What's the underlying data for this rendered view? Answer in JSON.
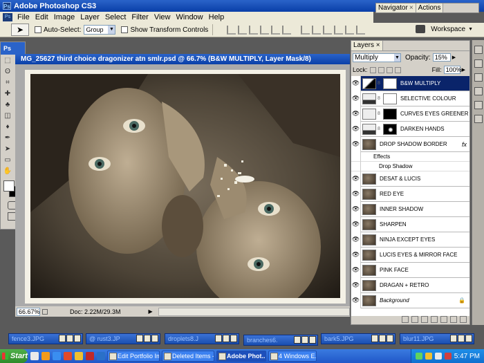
{
  "app": {
    "title": "Adobe Photoshop CS3",
    "ps_badge": "Ps"
  },
  "menu": [
    "File",
    "Edit",
    "Image",
    "Layer",
    "Select",
    "Filter",
    "View",
    "Window",
    "Help"
  ],
  "navtabs": {
    "navigator": "Navigator",
    "actions": "Actions",
    "close": "×"
  },
  "options": {
    "auto_select_label": "Auto-Select:",
    "auto_select_value": "Group",
    "show_transform_label": "Show Transform Controls",
    "workspace_label": "Workspace"
  },
  "toolbox": {
    "title": "Ps"
  },
  "document": {
    "title": "MG_25627 third choice dragonizer atn smlr.psd @ 66.7% (B&W MULTIPLY, Layer Mask/8)",
    "zoom": "66.67%",
    "doc_info": "Doc: 2.22M/29.3M"
  },
  "layers": {
    "tab": "Layers",
    "close": "×",
    "blend_mode": "Multiply",
    "opacity_label": "Opacity:",
    "opacity": "15%",
    "lock_label": "Lock:",
    "fill_label": "Fill:",
    "fill": "100%",
    "items": [
      {
        "name": "B&W MULTIPLY"
      },
      {
        "name": "SELECTIVE COLOUR"
      },
      {
        "name": "CURVES EYES GREENER"
      },
      {
        "name": "DARKEN HANDS"
      },
      {
        "name": "DROP SHADOW BORDER",
        "fx": "fx"
      },
      {
        "name": "Effects"
      },
      {
        "name": "Drop Shadow"
      },
      {
        "name": "DESAT & LUCIS"
      },
      {
        "name": "RED EYE"
      },
      {
        "name": "INNER SHADOW"
      },
      {
        "name": "SHARPEN"
      },
      {
        "name": "NINJA EXCEPT EYES"
      },
      {
        "name": "LUCIS EYES & MIRROR FACE"
      },
      {
        "name": "PINK FACE"
      },
      {
        "name": "DRAGAN + RETRO"
      },
      {
        "name": "Background"
      }
    ]
  },
  "minimized": [
    {
      "label": "fence3.JPG"
    },
    {
      "label": "@ rust3.JP"
    },
    {
      "label": "droplets8.J"
    },
    {
      "label": "branches6."
    },
    {
      "label": "bark5.JPG"
    },
    {
      "label": "blur11.JPG"
    }
  ],
  "taskbar": {
    "start": "Start",
    "tasks": [
      "Edit Portfolio Im...",
      "Deleted Items - ...",
      "Adobe Phot...",
      "4 Windows E..."
    ],
    "clock": "5:47 PM"
  },
  "colors": {
    "titlebar": "#0a3fa8",
    "selected_layer": "#0a246a",
    "taskbar": "#2057c8"
  }
}
